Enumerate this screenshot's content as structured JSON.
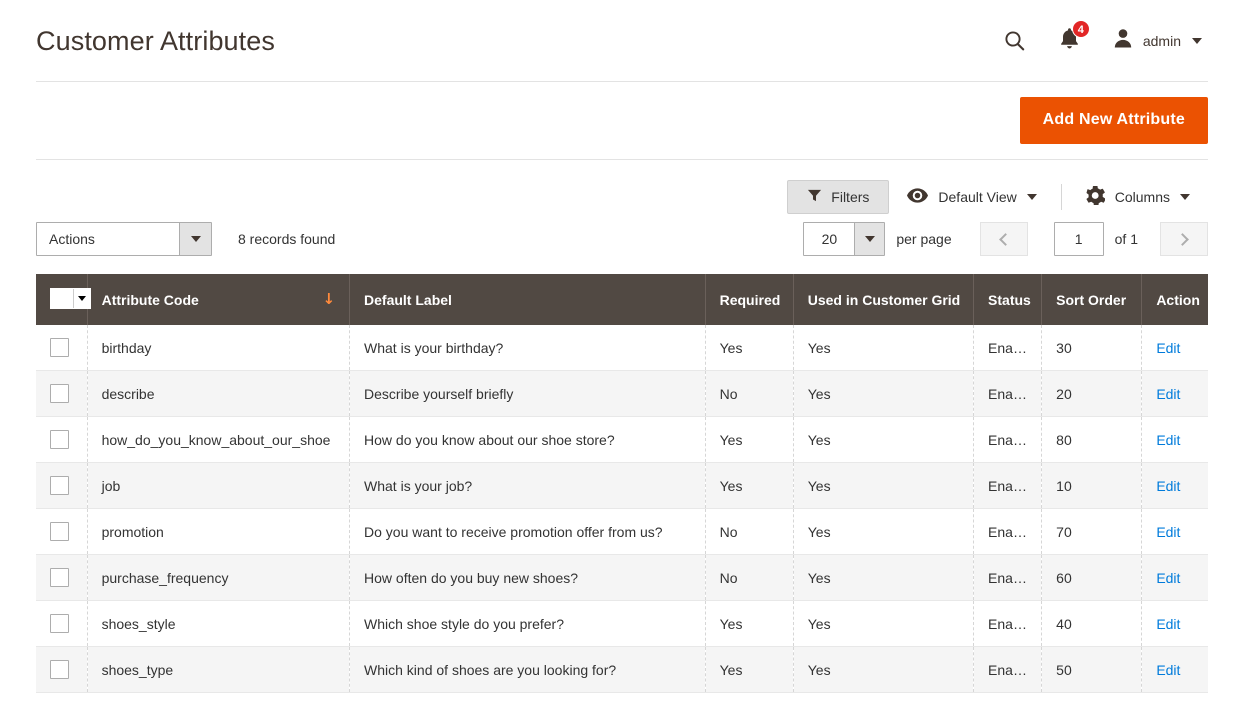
{
  "header": {
    "title": "Customer Attributes",
    "search_icon": "search-icon",
    "notifications_icon": "bell-icon",
    "notifications_count": "4",
    "user_icon": "user-avatar-icon",
    "user_name": "admin"
  },
  "action_bar": {
    "add_new_label": "Add New Attribute",
    "accent_color": "#eb5202"
  },
  "toolbar": {
    "filters_label": "Filters",
    "filters_icon": "funnel-icon",
    "view_icon": "eye-icon",
    "view_label": "Default View",
    "columns_icon": "gear-icon",
    "columns_label": "Columns"
  },
  "grid_header": {
    "actions_label": "Actions",
    "records_found": "8 records found",
    "per_page_value": "20",
    "per_page_label": "per page",
    "page_value": "1",
    "of_total": "of 1",
    "prev_icon": "chevron-left-icon",
    "next_icon": "chevron-right-icon"
  },
  "grid": {
    "sort_indicator": "↓",
    "sort_column": "Attribute Code",
    "sort_color": "#ff8a3c",
    "link_color": "#007bdb",
    "header_bg": "#514943",
    "columns": [
      {
        "key": "code",
        "label": "Attribute Code"
      },
      {
        "key": "label",
        "label": "Default Label"
      },
      {
        "key": "req",
        "label": "Required"
      },
      {
        "key": "grid",
        "label": "Used in Customer Grid"
      },
      {
        "key": "status",
        "label": "Status"
      },
      {
        "key": "sort",
        "label": "Sort Order"
      },
      {
        "key": "action",
        "label": "Action"
      }
    ],
    "rows": [
      {
        "code": "birthday",
        "label": "What is your birthday?",
        "req": "Yes",
        "grid": "Yes",
        "status": "Enable",
        "sort": "30",
        "action": "Edit"
      },
      {
        "code": "describe",
        "label": "Describe yourself briefly",
        "req": "No",
        "grid": "Yes",
        "status": "Enable",
        "sort": "20",
        "action": "Edit"
      },
      {
        "code": "how_do_you_know_about_our_shoe",
        "label": "How do you know about our shoe store?",
        "req": "Yes",
        "grid": "Yes",
        "status": "Enable",
        "sort": "80",
        "action": "Edit"
      },
      {
        "code": "job",
        "label": "What is your job?",
        "req": "Yes",
        "grid": "Yes",
        "status": "Enable",
        "sort": "10",
        "action": "Edit"
      },
      {
        "code": "promotion",
        "label": "Do you want to receive promotion offer from us?",
        "req": "No",
        "grid": "Yes",
        "status": "Enable",
        "sort": "70",
        "action": "Edit"
      },
      {
        "code": "purchase_frequency",
        "label": "How often do you buy new shoes?",
        "req": "No",
        "grid": "Yes",
        "status": "Enable",
        "sort": "60",
        "action": "Edit"
      },
      {
        "code": "shoes_style",
        "label": "Which shoe style do you prefer?",
        "req": "Yes",
        "grid": "Yes",
        "status": "Enable",
        "sort": "40",
        "action": "Edit"
      },
      {
        "code": "shoes_type",
        "label": "Which kind of shoes are you looking for?",
        "req": "Yes",
        "grid": "Yes",
        "status": "Enable",
        "sort": "50",
        "action": "Edit"
      }
    ]
  }
}
